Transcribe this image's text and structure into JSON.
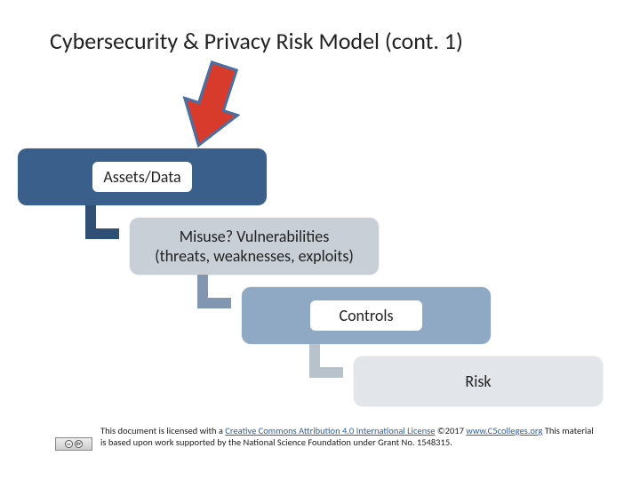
{
  "title": "Cybersecurity & Privacy Risk Model (cont. 1)",
  "boxes": {
    "assets": "Assets/Data",
    "misuse_line1": "Misuse?  Vulnerabilities",
    "misuse_line2": "(threats, weaknesses, exploits)",
    "controls": "Controls",
    "risk": "Risk"
  },
  "footer": {
    "prefix": "This document is licensed with a ",
    "license_link": "Creative Commons Attribution 4.0 International License",
    "mid": "  ©2017 ",
    "site_link": "www.C5colleges.org",
    "suffix": " This material is based upon work supported by the National Science Foundation under Grant No. 1548315."
  },
  "colors": {
    "arrow_fill": "#d83a2b",
    "arrow_stroke": "#4a6fa1",
    "conn1": "#2f4f74",
    "conn2": "#8197b1",
    "conn3": "#b8c2cd"
  }
}
